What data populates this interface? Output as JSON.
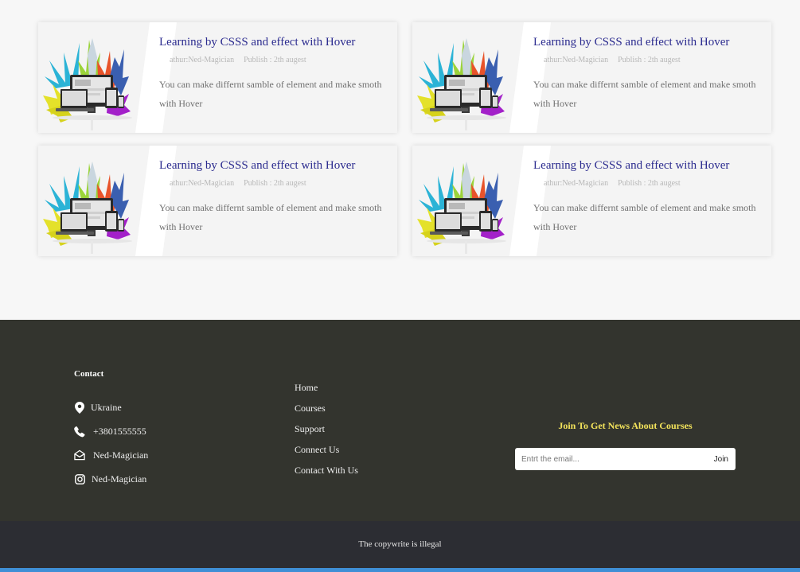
{
  "cards": [
    {
      "title": "Learning by CSSS and effect with Hover",
      "author": "athur:Ned-Magician",
      "publish": "Publish : 2th augest",
      "description": "You can make differnt samble of element and make smoth with Hover",
      "image_icon": "paint-splash-devices-image"
    },
    {
      "title": "Learning by CSSS and effect with Hover",
      "author": "athur:Ned-Magician",
      "publish": "Publish : 2th augest",
      "description": "You can make differnt samble of element and make smoth with Hover",
      "image_icon": "paint-splash-devices-image"
    },
    {
      "title": "Learning by CSSS and effect with Hover",
      "author": "athur:Ned-Magician",
      "publish": "Publish : 2th augest",
      "description": "You can make differnt samble of element and make smoth with Hover",
      "image_icon": "paint-splash-devices-image"
    },
    {
      "title": "Learning by CSSS and effect with Hover",
      "author": "athur:Ned-Magician",
      "publish": "Publish : 2th augest",
      "description": "You can make differnt samble of element and make smoth with Hover",
      "image_icon": "paint-splash-devices-image"
    }
  ],
  "footer": {
    "contact": {
      "heading": "Contact",
      "items": [
        {
          "icon": "location-pin-icon",
          "text": "Ukraine"
        },
        {
          "icon": "phone-icon",
          "text": "+3801555555"
        },
        {
          "icon": "envelope-icon",
          "text": "Ned-Magician"
        },
        {
          "icon": "instagram-icon",
          "text": "Ned-Magician"
        }
      ]
    },
    "links": [
      "Home",
      "Courses",
      "Support",
      "Connect Us",
      "Contact With Us"
    ],
    "newsletter": {
      "title": "Join To Get News About Courses",
      "placeholder": "Entrt the email...",
      "button": "Join"
    }
  },
  "copyright": "The copywrite is illegal",
  "colors": {
    "page_background": "#f7f7f7",
    "card_title": "#2b2b8f",
    "footer_background": "#33342e",
    "newsletter_title": "#f3e35b",
    "copyright_background": "#2c2d33",
    "bottom_accent": "#3f8fd6"
  }
}
